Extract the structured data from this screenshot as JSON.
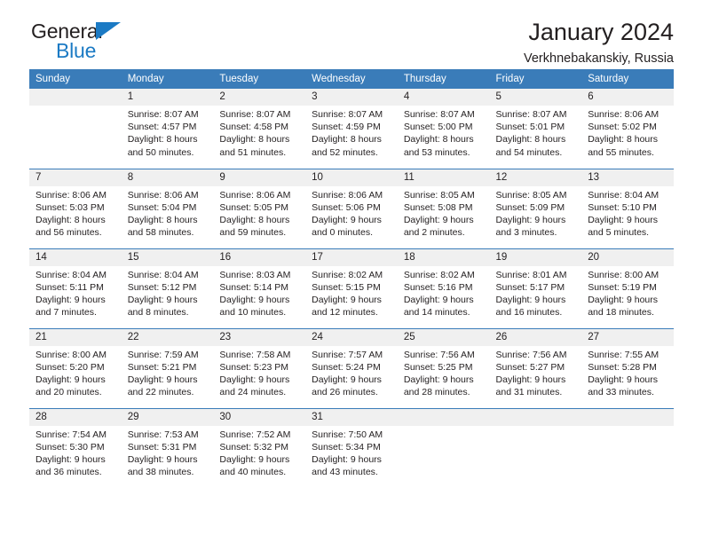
{
  "brand": {
    "name_top": "General",
    "name_bottom": "Blue",
    "accent_color": "#1b7ac4"
  },
  "header": {
    "title": "January 2024",
    "location": "Verkhnebakanskiy, Russia"
  },
  "theme": {
    "header_row_bg": "#3a7cb9",
    "daynum_bg": "#f0f0f0",
    "text_color": "#231f20"
  },
  "calendar": {
    "day_names": [
      "Sunday",
      "Monday",
      "Tuesday",
      "Wednesday",
      "Thursday",
      "Friday",
      "Saturday"
    ],
    "labels": {
      "sunrise": "Sunrise:",
      "sunset": "Sunset:",
      "daylight": "Daylight:"
    },
    "weeks": [
      [
        {
          "day": "",
          "blank": true
        },
        {
          "day": "1",
          "sunrise": "Sunrise: 8:07 AM",
          "sunset": "Sunset: 4:57 PM",
          "daylight1": "Daylight: 8 hours",
          "daylight2": "and 50 minutes."
        },
        {
          "day": "2",
          "sunrise": "Sunrise: 8:07 AM",
          "sunset": "Sunset: 4:58 PM",
          "daylight1": "Daylight: 8 hours",
          "daylight2": "and 51 minutes."
        },
        {
          "day": "3",
          "sunrise": "Sunrise: 8:07 AM",
          "sunset": "Sunset: 4:59 PM",
          "daylight1": "Daylight: 8 hours",
          "daylight2": "and 52 minutes."
        },
        {
          "day": "4",
          "sunrise": "Sunrise: 8:07 AM",
          "sunset": "Sunset: 5:00 PM",
          "daylight1": "Daylight: 8 hours",
          "daylight2": "and 53 minutes."
        },
        {
          "day": "5",
          "sunrise": "Sunrise: 8:07 AM",
          "sunset": "Sunset: 5:01 PM",
          "daylight1": "Daylight: 8 hours",
          "daylight2": "and 54 minutes."
        },
        {
          "day": "6",
          "sunrise": "Sunrise: 8:06 AM",
          "sunset": "Sunset: 5:02 PM",
          "daylight1": "Daylight: 8 hours",
          "daylight2": "and 55 minutes."
        }
      ],
      [
        {
          "day": "7",
          "sunrise": "Sunrise: 8:06 AM",
          "sunset": "Sunset: 5:03 PM",
          "daylight1": "Daylight: 8 hours",
          "daylight2": "and 56 minutes."
        },
        {
          "day": "8",
          "sunrise": "Sunrise: 8:06 AM",
          "sunset": "Sunset: 5:04 PM",
          "daylight1": "Daylight: 8 hours",
          "daylight2": "and 58 minutes."
        },
        {
          "day": "9",
          "sunrise": "Sunrise: 8:06 AM",
          "sunset": "Sunset: 5:05 PM",
          "daylight1": "Daylight: 8 hours",
          "daylight2": "and 59 minutes."
        },
        {
          "day": "10",
          "sunrise": "Sunrise: 8:06 AM",
          "sunset": "Sunset: 5:06 PM",
          "daylight1": "Daylight: 9 hours",
          "daylight2": "and 0 minutes."
        },
        {
          "day": "11",
          "sunrise": "Sunrise: 8:05 AM",
          "sunset": "Sunset: 5:08 PM",
          "daylight1": "Daylight: 9 hours",
          "daylight2": "and 2 minutes."
        },
        {
          "day": "12",
          "sunrise": "Sunrise: 8:05 AM",
          "sunset": "Sunset: 5:09 PM",
          "daylight1": "Daylight: 9 hours",
          "daylight2": "and 3 minutes."
        },
        {
          "day": "13",
          "sunrise": "Sunrise: 8:04 AM",
          "sunset": "Sunset: 5:10 PM",
          "daylight1": "Daylight: 9 hours",
          "daylight2": "and 5 minutes."
        }
      ],
      [
        {
          "day": "14",
          "sunrise": "Sunrise: 8:04 AM",
          "sunset": "Sunset: 5:11 PM",
          "daylight1": "Daylight: 9 hours",
          "daylight2": "and 7 minutes."
        },
        {
          "day": "15",
          "sunrise": "Sunrise: 8:04 AM",
          "sunset": "Sunset: 5:12 PM",
          "daylight1": "Daylight: 9 hours",
          "daylight2": "and 8 minutes."
        },
        {
          "day": "16",
          "sunrise": "Sunrise: 8:03 AM",
          "sunset": "Sunset: 5:14 PM",
          "daylight1": "Daylight: 9 hours",
          "daylight2": "and 10 minutes."
        },
        {
          "day": "17",
          "sunrise": "Sunrise: 8:02 AM",
          "sunset": "Sunset: 5:15 PM",
          "daylight1": "Daylight: 9 hours",
          "daylight2": "and 12 minutes."
        },
        {
          "day": "18",
          "sunrise": "Sunrise: 8:02 AM",
          "sunset": "Sunset: 5:16 PM",
          "daylight1": "Daylight: 9 hours",
          "daylight2": "and 14 minutes."
        },
        {
          "day": "19",
          "sunrise": "Sunrise: 8:01 AM",
          "sunset": "Sunset: 5:17 PM",
          "daylight1": "Daylight: 9 hours",
          "daylight2": "and 16 minutes."
        },
        {
          "day": "20",
          "sunrise": "Sunrise: 8:00 AM",
          "sunset": "Sunset: 5:19 PM",
          "daylight1": "Daylight: 9 hours",
          "daylight2": "and 18 minutes."
        }
      ],
      [
        {
          "day": "21",
          "sunrise": "Sunrise: 8:00 AM",
          "sunset": "Sunset: 5:20 PM",
          "daylight1": "Daylight: 9 hours",
          "daylight2": "and 20 minutes."
        },
        {
          "day": "22",
          "sunrise": "Sunrise: 7:59 AM",
          "sunset": "Sunset: 5:21 PM",
          "daylight1": "Daylight: 9 hours",
          "daylight2": "and 22 minutes."
        },
        {
          "day": "23",
          "sunrise": "Sunrise: 7:58 AM",
          "sunset": "Sunset: 5:23 PM",
          "daylight1": "Daylight: 9 hours",
          "daylight2": "and 24 minutes."
        },
        {
          "day": "24",
          "sunrise": "Sunrise: 7:57 AM",
          "sunset": "Sunset: 5:24 PM",
          "daylight1": "Daylight: 9 hours",
          "daylight2": "and 26 minutes."
        },
        {
          "day": "25",
          "sunrise": "Sunrise: 7:56 AM",
          "sunset": "Sunset: 5:25 PM",
          "daylight1": "Daylight: 9 hours",
          "daylight2": "and 28 minutes."
        },
        {
          "day": "26",
          "sunrise": "Sunrise: 7:56 AM",
          "sunset": "Sunset: 5:27 PM",
          "daylight1": "Daylight: 9 hours",
          "daylight2": "and 31 minutes."
        },
        {
          "day": "27",
          "sunrise": "Sunrise: 7:55 AM",
          "sunset": "Sunset: 5:28 PM",
          "daylight1": "Daylight: 9 hours",
          "daylight2": "and 33 minutes."
        }
      ],
      [
        {
          "day": "28",
          "sunrise": "Sunrise: 7:54 AM",
          "sunset": "Sunset: 5:30 PM",
          "daylight1": "Daylight: 9 hours",
          "daylight2": "and 36 minutes."
        },
        {
          "day": "29",
          "sunrise": "Sunrise: 7:53 AM",
          "sunset": "Sunset: 5:31 PM",
          "daylight1": "Daylight: 9 hours",
          "daylight2": "and 38 minutes."
        },
        {
          "day": "30",
          "sunrise": "Sunrise: 7:52 AM",
          "sunset": "Sunset: 5:32 PM",
          "daylight1": "Daylight: 9 hours",
          "daylight2": "and 40 minutes."
        },
        {
          "day": "31",
          "sunrise": "Sunrise: 7:50 AM",
          "sunset": "Sunset: 5:34 PM",
          "daylight1": "Daylight: 9 hours",
          "daylight2": "and 43 minutes."
        },
        {
          "day": "",
          "blank": true
        },
        {
          "day": "",
          "blank": true
        },
        {
          "day": "",
          "blank": true
        }
      ]
    ]
  }
}
